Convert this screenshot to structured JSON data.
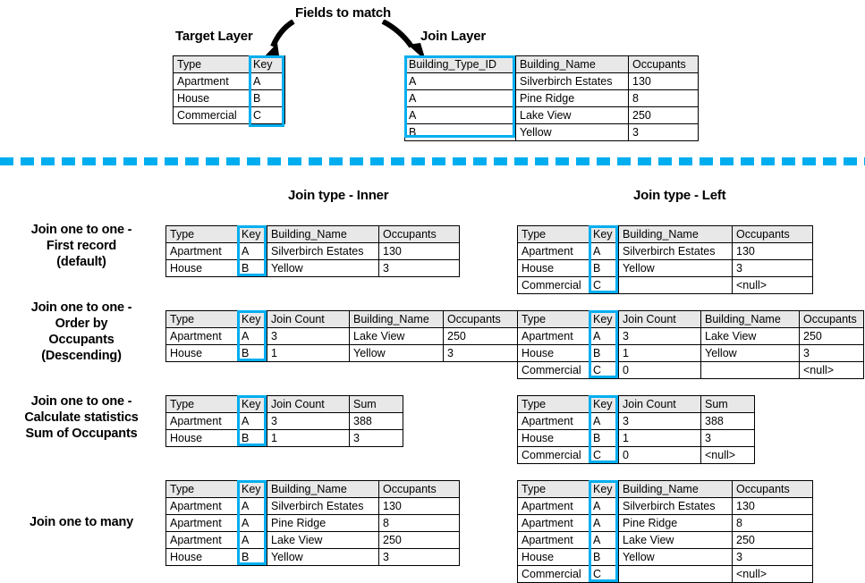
{
  "top": {
    "fields_to_match_label": "Fields to match",
    "target_layer_label": "Target Layer",
    "join_layer_label": "Join Layer",
    "target_table": {
      "columns": [
        "Type",
        "Key"
      ],
      "rows": [
        [
          "Apartment",
          "A"
        ],
        [
          "House",
          "B"
        ],
        [
          "Commercial",
          "C"
        ]
      ]
    },
    "join_table": {
      "columns": [
        "Building_Type_ID",
        "Building_Name",
        "Occupants"
      ],
      "rows": [
        [
          "A",
          "Silverbirch Estates",
          "130"
        ],
        [
          "A",
          "Pine Ridge",
          "8"
        ],
        [
          "A",
          "Lake View",
          "250"
        ],
        [
          "B",
          "Yellow",
          "3"
        ]
      ]
    }
  },
  "columns_headers": {
    "inner": "Join type - Inner",
    "left": "Join type - Left"
  },
  "row_labels": [
    "Join one to one -\nFirst record\n(default)",
    "Join one to one -\nOrder by\nOccupants\n(Descending)",
    "Join one to one -\nCalculate statistics\nSum of Occupants",
    "Join one to many"
  ],
  "tables": {
    "r1_inner": {
      "columns": [
        "Type",
        "Key",
        "Building_Name",
        "Occupants"
      ],
      "rows": [
        [
          "Apartment",
          "A",
          "Silverbirch Estates",
          "130"
        ],
        [
          "House",
          "B",
          "Yellow",
          "3"
        ]
      ]
    },
    "r1_left": {
      "columns": [
        "Type",
        "Key",
        "Building_Name",
        "Occupants"
      ],
      "rows": [
        [
          "Apartment",
          "A",
          "Silverbirch Estates",
          "130"
        ],
        [
          "House",
          "B",
          "Yellow",
          "3"
        ],
        [
          "Commercial",
          "C",
          "",
          "<null>"
        ]
      ]
    },
    "r2_inner": {
      "columns": [
        "Type",
        "Key",
        "Join Count",
        "Building_Name",
        "Occupants"
      ],
      "rows": [
        [
          "Apartment",
          "A",
          "3",
          "Lake View",
          "250"
        ],
        [
          "House",
          "B",
          "1",
          "Yellow",
          "3"
        ]
      ]
    },
    "r2_left": {
      "columns": [
        "Type",
        "Key",
        "Join Count",
        "Building_Name",
        "Occupants"
      ],
      "rows": [
        [
          "Apartment",
          "A",
          "3",
          "Lake View",
          "250"
        ],
        [
          "House",
          "B",
          "1",
          "Yellow",
          "3"
        ],
        [
          "Commercial",
          "C",
          "0",
          "",
          "<null>"
        ]
      ]
    },
    "r3_inner": {
      "columns": [
        "Type",
        "Key",
        "Join Count",
        "Sum"
      ],
      "rows": [
        [
          "Apartment",
          "A",
          "3",
          "388"
        ],
        [
          "House",
          "B",
          "1",
          "3"
        ]
      ]
    },
    "r3_left": {
      "columns": [
        "Type",
        "Key",
        "Join Count",
        "Sum"
      ],
      "rows": [
        [
          "Apartment",
          "A",
          "3",
          "388"
        ],
        [
          "House",
          "B",
          "1",
          "3"
        ],
        [
          "Commercial",
          "C",
          "0",
          "<null>"
        ]
      ]
    },
    "r4_inner": {
      "columns": [
        "Type",
        "Key",
        "Building_Name",
        "Occupants"
      ],
      "rows": [
        [
          "Apartment",
          "A",
          "Silverbirch Estates",
          "130"
        ],
        [
          "Apartment",
          "A",
          "Pine Ridge",
          "8"
        ],
        [
          "Apartment",
          "A",
          "Lake View",
          "250"
        ],
        [
          "House",
          "B",
          "Yellow",
          "3"
        ]
      ]
    },
    "r4_left": {
      "columns": [
        "Type",
        "Key",
        "Building_Name",
        "Occupants"
      ],
      "rows": [
        [
          "Apartment",
          "A",
          "Silverbirch Estates",
          "130"
        ],
        [
          "Apartment",
          "A",
          "Pine Ridge",
          "8"
        ],
        [
          "Apartment",
          "A",
          "Lake View",
          "250"
        ],
        [
          "House",
          "B",
          "Yellow",
          "3"
        ],
        [
          "Commercial",
          "C",
          "",
          "<null>"
        ]
      ]
    }
  },
  "colors": {
    "highlight": "#00AEEF",
    "header_fill": "#E8E8E8",
    "border": "#000000",
    "text": "#000000"
  }
}
